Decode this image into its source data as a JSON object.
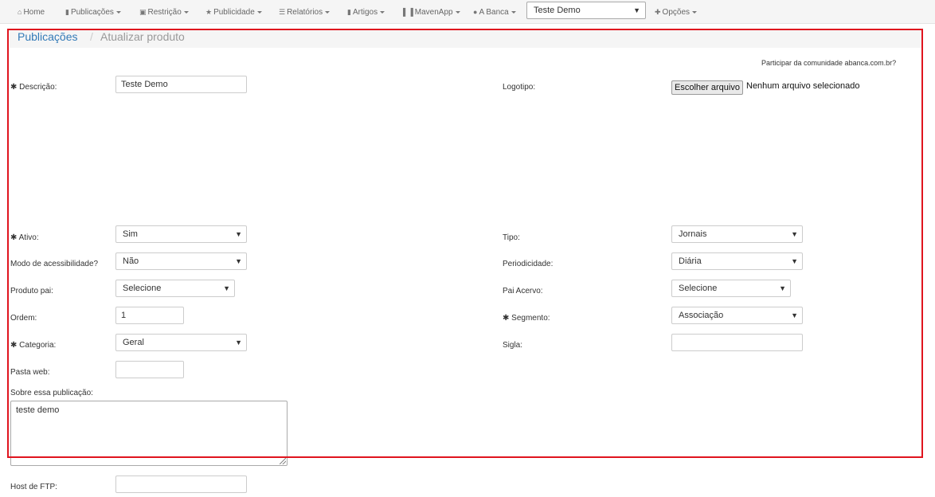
{
  "nav": {
    "home": "Home",
    "publicacoes": "Publicações",
    "restricao": "Restrição",
    "publicidade": "Publicidade",
    "relatorios": "Relatórios",
    "artigos": "Artigos",
    "mavenapp": "MavenApp",
    "abanca": "A Banca",
    "selected_product": "Teste Demo",
    "opcoes": "Opções"
  },
  "breadcrumb": {
    "parent": "Publicações",
    "separator": "/",
    "current": "Atualizar produto"
  },
  "community_link": "Participar da comunidade abanca.com.br?",
  "form": {
    "required_mark": "✱",
    "descricao": {
      "label": "Descrição:",
      "value": "Teste Demo"
    },
    "logotipo": {
      "label": "Logotipo:",
      "button": "Escolher arquivo",
      "status": "Nenhum arquivo selecionado"
    },
    "ativo": {
      "label": "Ativo:",
      "value": "Sim"
    },
    "tipo": {
      "label": "Tipo:",
      "value": "Jornais"
    },
    "acessibilidade": {
      "label": "Modo de acessibilidade?",
      "value": "Não"
    },
    "periodicidade": {
      "label": "Periodicidade:",
      "value": "Diária"
    },
    "produto_pai": {
      "label": "Produto pai:",
      "value": "Selecione"
    },
    "pai_acervo": {
      "label": "Pai Acervo:",
      "value": "Selecione"
    },
    "ordem": {
      "label": "Ordem:",
      "value": "1"
    },
    "segmento": {
      "label": "Segmento:",
      "value": "Associação"
    },
    "categoria": {
      "label": "Categoria:",
      "value": "Geral"
    },
    "sigla": {
      "label": "Sigla:",
      "value": ""
    },
    "pasta_web": {
      "label": "Pasta web:",
      "value": ""
    },
    "sobre": {
      "label": "Sobre essa publicação:",
      "value": "teste demo"
    },
    "host_ftp": {
      "label": "Host de FTP:",
      "value": ""
    }
  },
  "icons": {
    "home": "home-icon",
    "file": "file-icon",
    "lock": "lock-icon",
    "star": "star-icon",
    "list": "list-icon",
    "bookmark": "bookmark-icon",
    "barcode": "barcode-icon",
    "globe": "globe-icon",
    "plus": "plus-icon",
    "dropdown": "chevron-down-icon"
  },
  "colors": {
    "link": "#337ab7",
    "highlight": "#e0141e",
    "navbar_bg": "#f5f5f5"
  }
}
